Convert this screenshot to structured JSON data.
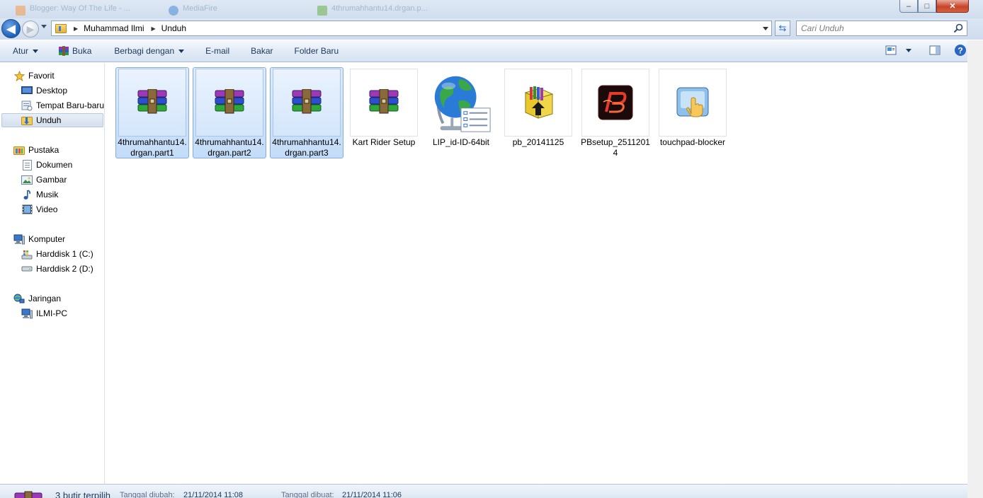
{
  "window": {
    "ghost_tabs": [
      "Blogger: Way Of The Life - ...",
      "MediaFire",
      "4thrumahhantu14.drgan.p..."
    ],
    "controls": {
      "minimize": "–",
      "maximize": "□",
      "close": "✕"
    }
  },
  "navigation": {
    "back_glyph": "◀",
    "forward_glyph": "▶"
  },
  "address": {
    "breadcrumbs": [
      "Muhammad Ilmi",
      "Unduh"
    ]
  },
  "search": {
    "placeholder": "Cari Unduh"
  },
  "toolbar": {
    "organize": "Atur",
    "open": "Buka",
    "share": "Berbagi dengan",
    "email": "E-mail",
    "burn": "Bakar",
    "new_folder": "Folder Baru"
  },
  "sidebar": {
    "favorites": {
      "label": "Favorit",
      "items": [
        "Desktop",
        "Tempat Baru-baru",
        "Unduh"
      ]
    },
    "libraries": {
      "label": "Pustaka",
      "items": [
        "Dokumen",
        "Gambar",
        "Musik",
        "Video"
      ]
    },
    "computer": {
      "label": "Komputer",
      "items": [
        "Harddisk 1 (C:)",
        "Harddisk 2 (D:)"
      ]
    },
    "network": {
      "label": "Jaringan",
      "items": [
        "ILMI-PC"
      ]
    }
  },
  "files": [
    {
      "name": "4thrumahhantu14.drgan.part1",
      "icon": "winrar-archive-icon",
      "selected": true
    },
    {
      "name": "4thrumahhantu14.drgan.part2",
      "icon": "winrar-archive-icon",
      "selected": true
    },
    {
      "name": "4thrumahhantu14.drgan.part3",
      "icon": "winrar-archive-icon",
      "selected": true
    },
    {
      "name": "Kart Rider Setup",
      "icon": "winrar-archive-icon",
      "selected": false
    },
    {
      "name": "LIP_id-ID-64bit",
      "icon": "globe-installer-icon",
      "selected": false
    },
    {
      "name": "pb_20141125",
      "icon": "winzip-sfx-icon",
      "selected": false
    },
    {
      "name": "PBsetup_25112014",
      "icon": "pointblank-logo-icon",
      "selected": false
    },
    {
      "name": "touchpad-blocker",
      "icon": "touchpad-hand-icon",
      "selected": false
    }
  ],
  "status": {
    "selection": "3 butir terpilih",
    "modified_label": "Tanggal diubah:",
    "modified_value": "21/11/2014 11:08",
    "created_label": "Tanggal dibuat:",
    "created_value": "21/11/2014 11:06"
  },
  "colors": {
    "selection_fill": "#c3dcf8",
    "selection_border": "#84acdd",
    "toolbar_text": "#1e395b"
  }
}
